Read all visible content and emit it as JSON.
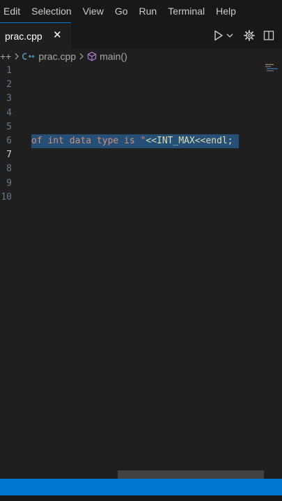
{
  "menu": {
    "items": [
      "Edit",
      "Selection",
      "View",
      "Go",
      "Run",
      "Terminal",
      "Help"
    ]
  },
  "tabs": [
    {
      "label": "prac.cpp",
      "close": "✕"
    }
  ],
  "breadcrumb": {
    "prefix": "++",
    "file": "prac.cpp",
    "symbol": "main()"
  },
  "editor": {
    "line_numbers": [
      "1",
      "2",
      "3",
      "4",
      "5",
      "6",
      "7",
      "8",
      "9",
      "10"
    ],
    "active_line": "7",
    "selected_line": {
      "string_part": "of int data type is \"",
      "rest_part": "<<INT_MAX<<endl;"
    }
  },
  "colors": {
    "accent": "#0078d4",
    "selection": "#264f78",
    "cpp_icon": "#519aba",
    "symbol_icon": "#b180d7"
  }
}
